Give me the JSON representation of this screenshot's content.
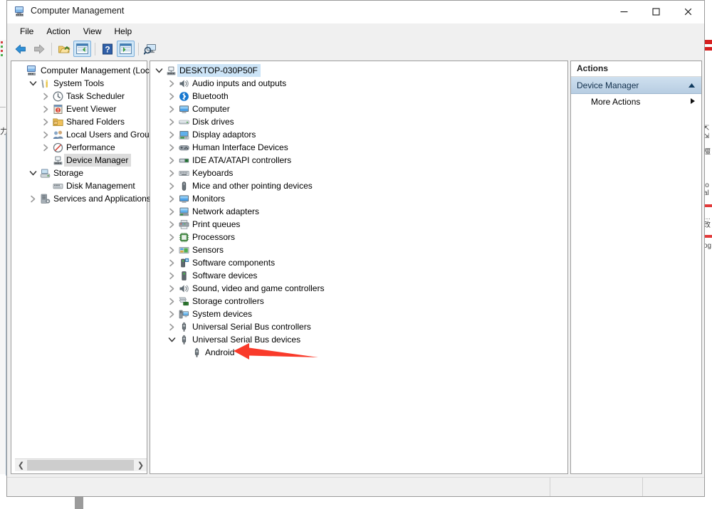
{
  "window": {
    "title": "Computer Management",
    "icon": "computer-management-icon",
    "buttons": {
      "minimize": "–",
      "maximize": "☐",
      "close": "✕"
    }
  },
  "menubar": {
    "items": [
      "File",
      "Action",
      "View",
      "Help"
    ]
  },
  "toolbar": {
    "items": [
      {
        "name": "back-button",
        "icon": "back-arrow-icon",
        "selected": false
      },
      {
        "name": "forward-button",
        "icon": "forward-arrow-icon",
        "selected": false
      },
      {
        "name": "up-one-level-button",
        "icon": "folder-up-icon",
        "selected": false
      },
      {
        "name": "show-hide-console-tree-button",
        "icon": "console-tree-icon",
        "selected": true
      },
      {
        "name": "help-button",
        "icon": "question-mark-icon",
        "selected": false
      },
      {
        "name": "show-hide-action-pane-button",
        "icon": "action-pane-icon",
        "selected": true
      },
      {
        "name": "scan-for-hardware-changes-button",
        "icon": "scan-hardware-icon",
        "selected": false
      }
    ]
  },
  "console_tree": {
    "items": [
      {
        "label": "Computer Management (Local",
        "indent": 0,
        "chevron": "none",
        "icon": "computer-management-icon",
        "selected": false
      },
      {
        "label": "System Tools",
        "indent": 1,
        "chevron": "expanded",
        "icon": "system-tools-icon",
        "selected": false
      },
      {
        "label": "Task Scheduler",
        "indent": 2,
        "chevron": "collapsed",
        "icon": "clock-icon",
        "selected": false
      },
      {
        "label": "Event Viewer",
        "indent": 2,
        "chevron": "collapsed",
        "icon": "event-viewer-icon",
        "selected": false
      },
      {
        "label": "Shared Folders",
        "indent": 2,
        "chevron": "collapsed",
        "icon": "shared-folders-icon",
        "selected": false
      },
      {
        "label": "Local Users and Groups",
        "indent": 2,
        "chevron": "collapsed",
        "icon": "users-group-icon",
        "selected": false
      },
      {
        "label": "Performance",
        "indent": 2,
        "chevron": "collapsed",
        "icon": "performance-icon",
        "selected": false
      },
      {
        "label": "Device Manager",
        "indent": 2,
        "chevron": "none",
        "icon": "device-manager-icon",
        "selected": true
      },
      {
        "label": "Storage",
        "indent": 1,
        "chevron": "expanded",
        "icon": "storage-icon",
        "selected": false
      },
      {
        "label": "Disk Management",
        "indent": 2,
        "chevron": "none",
        "icon": "disk-management-icon",
        "selected": false
      },
      {
        "label": "Services and Applications",
        "indent": 1,
        "chevron": "collapsed",
        "icon": "services-icon",
        "selected": false
      }
    ]
  },
  "device_tree": {
    "items": [
      {
        "label": "DESKTOP-030P50F",
        "indent": 0,
        "chevron": "expanded",
        "icon": "computer-root-icon",
        "selected": true
      },
      {
        "label": "Audio inputs and outputs",
        "indent": 1,
        "chevron": "collapsed",
        "icon": "speaker-icon",
        "selected": false
      },
      {
        "label": "Bluetooth",
        "indent": 1,
        "chevron": "collapsed",
        "icon": "bluetooth-icon",
        "selected": false
      },
      {
        "label": "Computer",
        "indent": 1,
        "chevron": "collapsed",
        "icon": "monitor-icon",
        "selected": false
      },
      {
        "label": "Disk drives",
        "indent": 1,
        "chevron": "collapsed",
        "icon": "disk-drive-icon",
        "selected": false
      },
      {
        "label": "Display adaptors",
        "indent": 1,
        "chevron": "collapsed",
        "icon": "display-adapter-icon",
        "selected": false
      },
      {
        "label": "Human Interface Devices",
        "indent": 1,
        "chevron": "collapsed",
        "icon": "gamepad-icon",
        "selected": false
      },
      {
        "label": "IDE ATA/ATAPI controllers",
        "indent": 1,
        "chevron": "collapsed",
        "icon": "ide-controller-icon",
        "selected": false
      },
      {
        "label": "Keyboards",
        "indent": 1,
        "chevron": "collapsed",
        "icon": "keyboard-icon",
        "selected": false
      },
      {
        "label": "Mice and other pointing devices",
        "indent": 1,
        "chevron": "collapsed",
        "icon": "mouse-icon",
        "selected": false
      },
      {
        "label": "Monitors",
        "indent": 1,
        "chevron": "collapsed",
        "icon": "monitor-icon",
        "selected": false
      },
      {
        "label": "Network adapters",
        "indent": 1,
        "chevron": "collapsed",
        "icon": "network-adapter-icon",
        "selected": false
      },
      {
        "label": "Print queues",
        "indent": 1,
        "chevron": "collapsed",
        "icon": "printer-icon",
        "selected": false
      },
      {
        "label": "Processors",
        "indent": 1,
        "chevron": "collapsed",
        "icon": "processor-icon",
        "selected": false
      },
      {
        "label": "Sensors",
        "indent": 1,
        "chevron": "collapsed",
        "icon": "sensor-icon",
        "selected": false
      },
      {
        "label": "Software components",
        "indent": 1,
        "chevron": "collapsed",
        "icon": "software-component-icon",
        "selected": false
      },
      {
        "label": "Software devices",
        "indent": 1,
        "chevron": "collapsed",
        "icon": "software-device-icon",
        "selected": false
      },
      {
        "label": "Sound, video and game controllers",
        "indent": 1,
        "chevron": "collapsed",
        "icon": "speaker-icon",
        "selected": false
      },
      {
        "label": "Storage controllers",
        "indent": 1,
        "chevron": "collapsed",
        "icon": "storage-controller-icon",
        "selected": false
      },
      {
        "label": "System devices",
        "indent": 1,
        "chevron": "collapsed",
        "icon": "system-device-icon",
        "selected": false
      },
      {
        "label": "Universal Serial Bus controllers",
        "indent": 1,
        "chevron": "collapsed",
        "icon": "usb-icon",
        "selected": false
      },
      {
        "label": "Universal Serial Bus devices",
        "indent": 1,
        "chevron": "expanded",
        "icon": "usb-icon",
        "selected": false
      },
      {
        "label": "Android",
        "indent": 2,
        "chevron": "none",
        "icon": "usb-icon",
        "selected": false
      }
    ]
  },
  "actions_pane": {
    "header": "Actions",
    "group_label": "Device Manager",
    "group_collapse_icon": "chevron-up-icon",
    "items": [
      {
        "label": "More Actions",
        "submenu_icon": "triangle-right-icon"
      }
    ]
  },
  "annotation": {
    "type": "arrow",
    "color": "#f93a2a",
    "points_at": "Android"
  },
  "colors": {
    "selection_blue": "#cce4f7",
    "selection_grey": "#dcdcdc",
    "action_group_bg": "#bfd4e6",
    "window_bg": "#f0f0f0",
    "arrow_red": "#f93a2a"
  }
}
